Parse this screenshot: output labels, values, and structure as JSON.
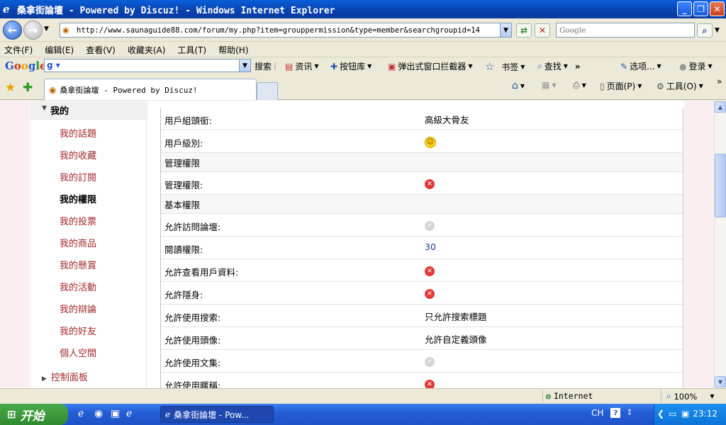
{
  "window": {
    "title": "桑拿街論壇 - Powered by Discuz! - Windows Internet Explorer",
    "minimize": "_",
    "restore": "❐",
    "close": "✕"
  },
  "address": {
    "url": "http://www.saunaguide88.com/forum/my.php?item=grouppermission&type=member&searchgroupid=14",
    "search_placeholder": "Google"
  },
  "menu": {
    "items": [
      "文件(F)",
      "编辑(E)",
      "查看(V)",
      "收藏夹(A)",
      "工具(T)",
      "帮助(H)"
    ]
  },
  "google_toolbar": {
    "search_label": "搜索",
    "items": [
      "资讯",
      "按钮库",
      "弹出式窗口拦截器",
      "书签",
      "查找",
      "选项...",
      "登录"
    ]
  },
  "tabs": {
    "active_label": "桑拿街論壇 - Powered by Discuz!",
    "tools": [
      "页面(P)",
      "工具(O)"
    ]
  },
  "sidebar": {
    "header": "我的",
    "items": [
      {
        "label": "我的話題",
        "active": false
      },
      {
        "label": "我的收藏",
        "active": false
      },
      {
        "label": "我的訂閱",
        "active": false
      },
      {
        "label": "我的權限",
        "active": true
      },
      {
        "label": "我的投票",
        "active": false
      },
      {
        "label": "我的商品",
        "active": false
      },
      {
        "label": "我的懸賞",
        "active": false
      },
      {
        "label": "我的活動",
        "active": false
      },
      {
        "label": "我的辯論",
        "active": false
      },
      {
        "label": "我的好友",
        "active": false
      },
      {
        "label": "個人空間",
        "active": false
      }
    ],
    "footer": "控制面板"
  },
  "permissions": {
    "rows": [
      {
        "key": "用戶組頭銜:",
        "type": "text",
        "value": "高級大骨友"
      },
      {
        "key": "用戶級別:",
        "type": "smile",
        "value": ""
      },
      {
        "key": "管理權限",
        "type": "section",
        "value": ""
      },
      {
        "key": "管理權限:",
        "type": "no",
        "value": ""
      },
      {
        "key": "基本權限",
        "type": "section",
        "value": ""
      },
      {
        "key": "允許訪問論壇:",
        "type": "yes",
        "value": ""
      },
      {
        "key": "閱讀權限:",
        "type": "num",
        "value": "30"
      },
      {
        "key": "允許查看用戶資料:",
        "type": "no",
        "value": ""
      },
      {
        "key": "允許隱身:",
        "type": "no",
        "value": ""
      },
      {
        "key": "允許使用搜索:",
        "type": "text",
        "value": "只允許搜索標題"
      },
      {
        "key": "允許使用頭像:",
        "type": "text",
        "value": "允許自定義頭像"
      },
      {
        "key": "允許使用文集:",
        "type": "yes",
        "value": ""
      },
      {
        "key": "允許使用暱稱:",
        "type": "no",
        "value": ""
      }
    ]
  },
  "status": {
    "zone": "Internet",
    "zoom": "100%"
  },
  "taskbar": {
    "start": "开始",
    "task": "桑拿街論壇 - Pow...",
    "ime": "CH",
    "clock": "23:12"
  }
}
